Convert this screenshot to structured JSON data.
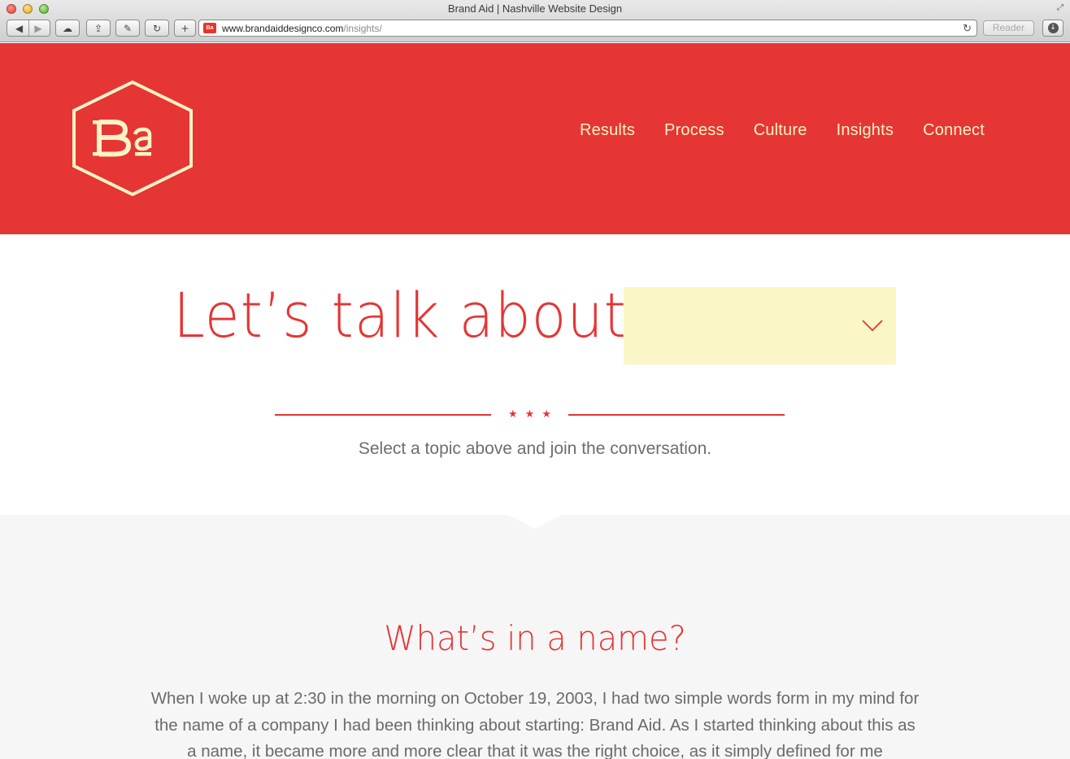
{
  "window": {
    "title": "Brand Aid | Nashville Website Design",
    "url_host": "www.brandaiddesignco.com",
    "url_path": "/insights/",
    "reader_label": "Reader"
  },
  "header": {
    "logo_text": "Ba",
    "brand_color": "#e63535",
    "cream_color": "#fbf3c4",
    "nav": [
      {
        "label": "Results"
      },
      {
        "label": "Process"
      },
      {
        "label": "Culture"
      },
      {
        "label": "Insights"
      },
      {
        "label": "Connect"
      }
    ]
  },
  "topic": {
    "headline": "Let’s talk about",
    "selected_value": "",
    "divider_stars": "★★★",
    "prompt": "Select a topic above and join the conversation."
  },
  "article": {
    "title": "What’s in a name?",
    "body": "When I woke up at 2:30 in the morning on October 19, 2003, I had two simple words form in my mind for the name of a company I had been thinking about starting: Brand Aid. As I started thinking about this as a name, it became more and more clear that it was the right choice, as it simply defined for me"
  }
}
